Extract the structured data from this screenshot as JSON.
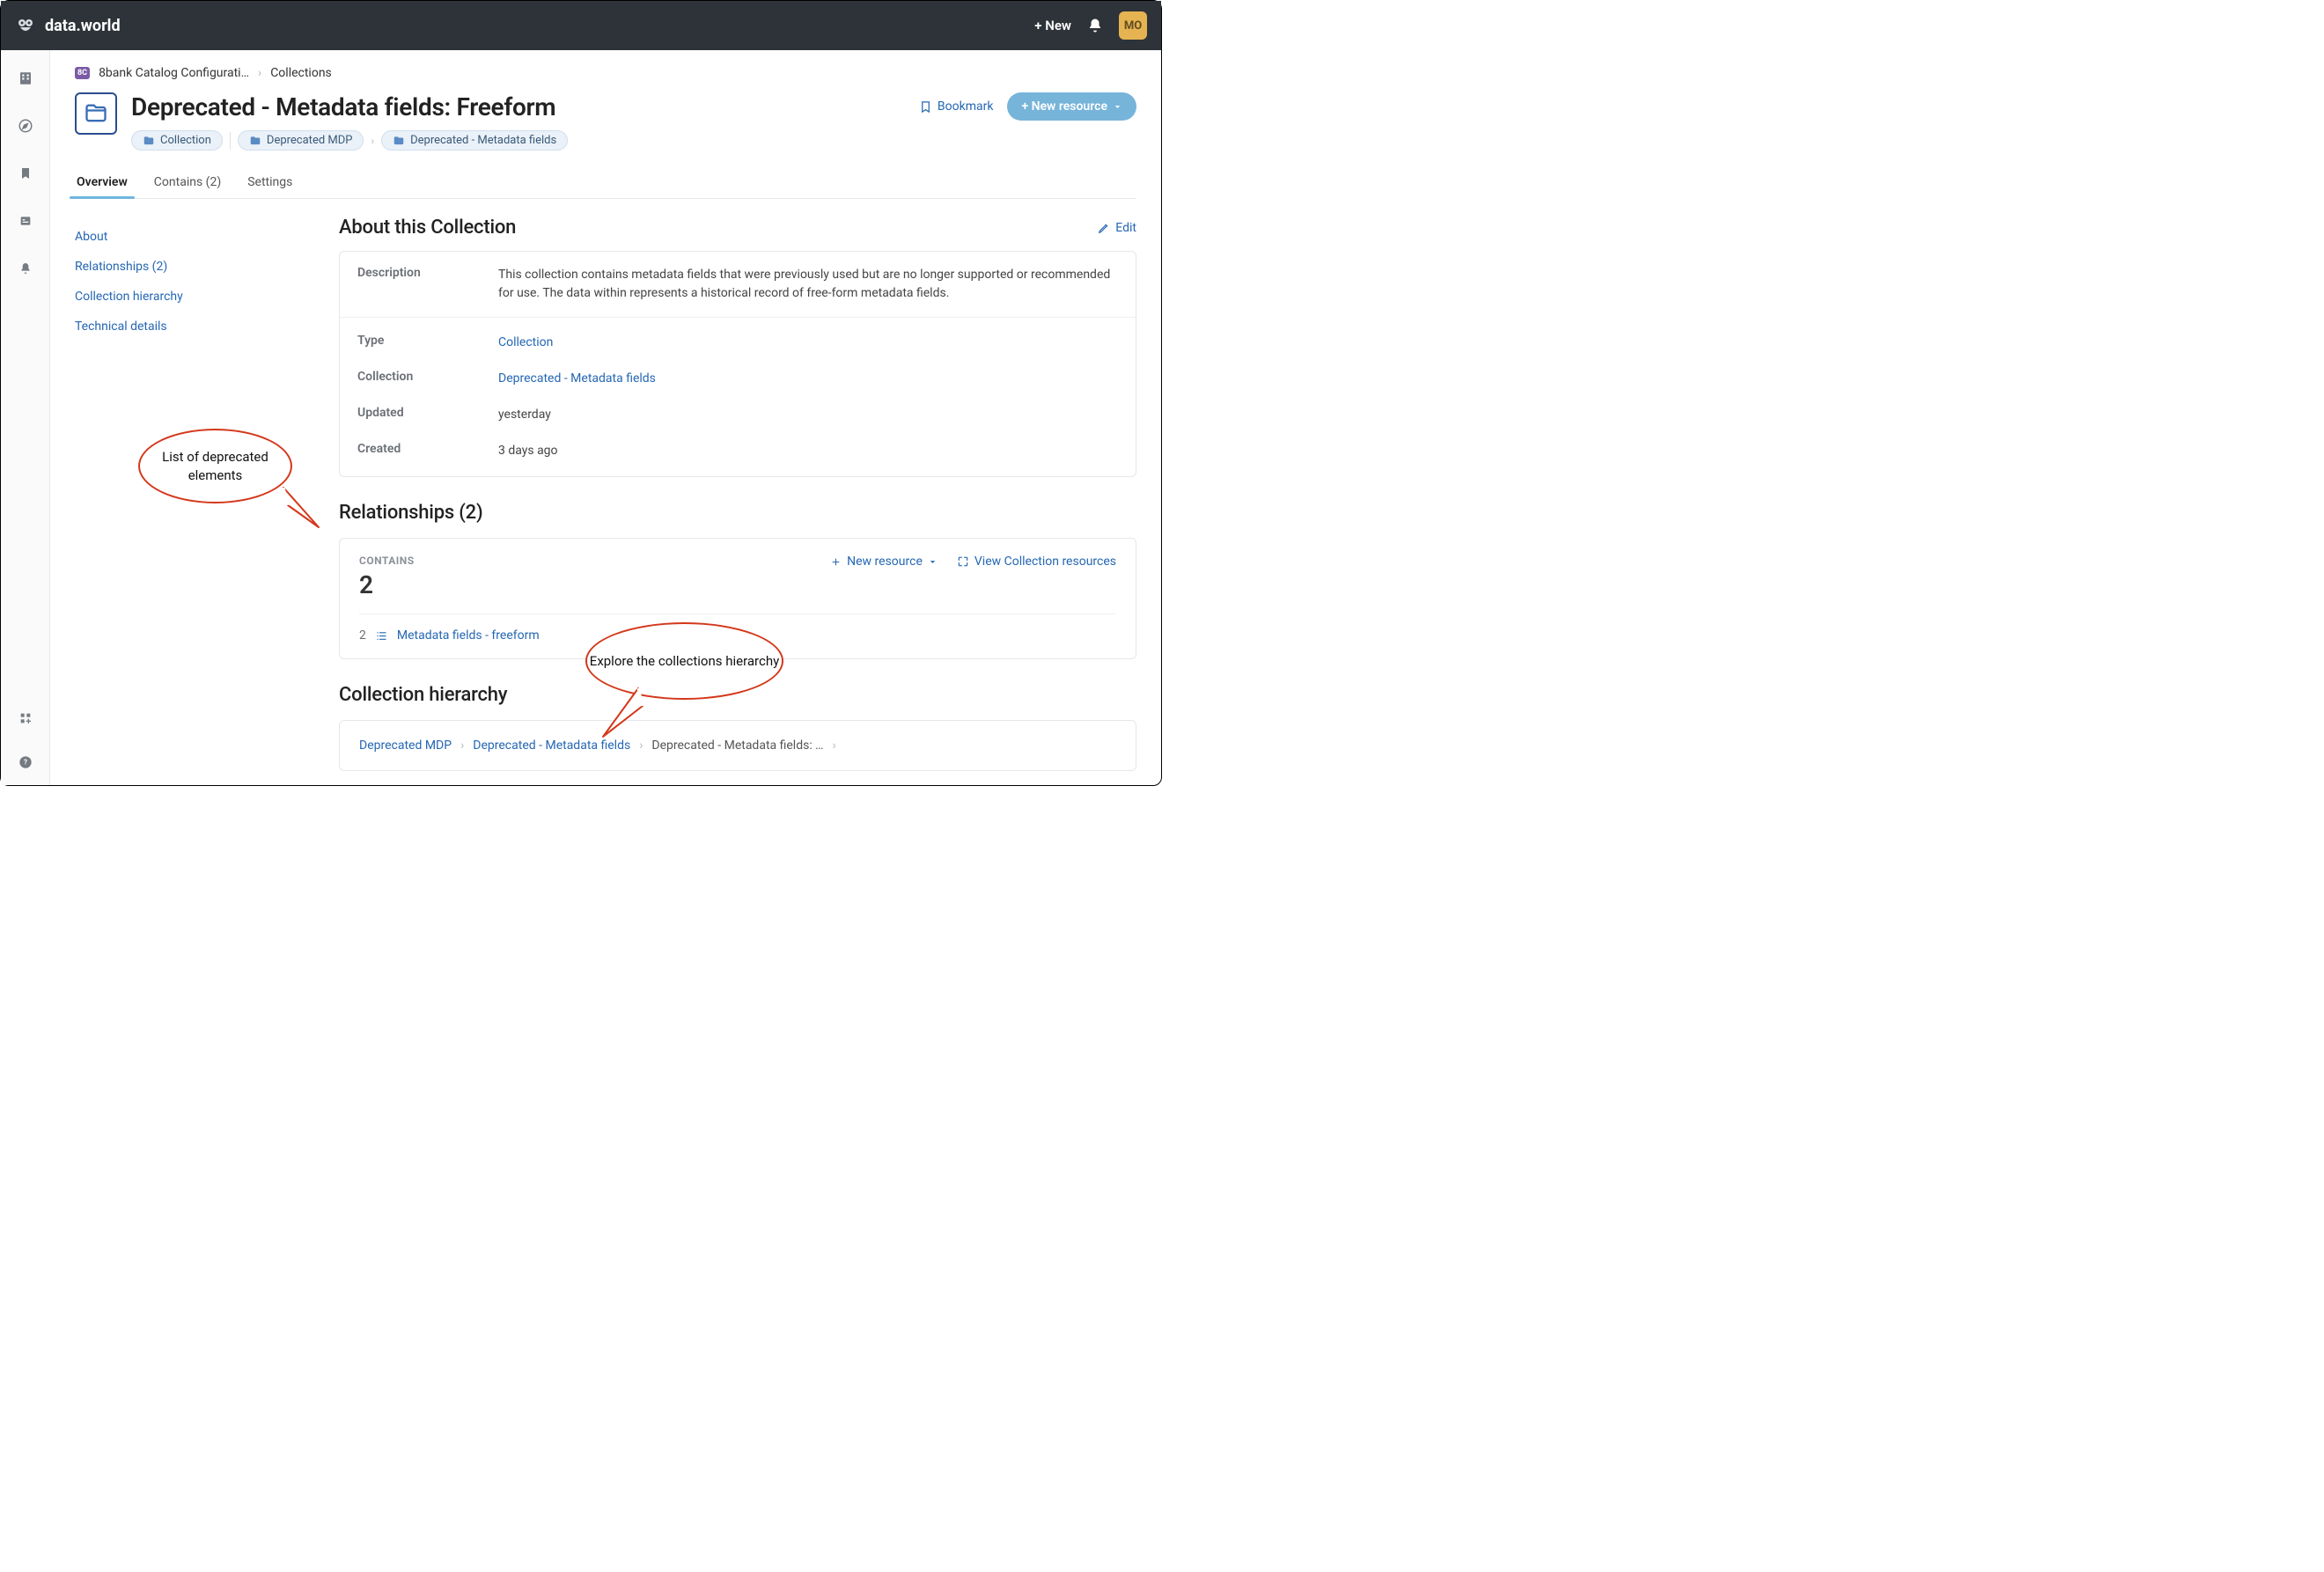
{
  "topbar": {
    "logo": "data.world",
    "new_label": "+ New",
    "avatar": "MO"
  },
  "breadcrumb": {
    "badge": "8C",
    "item1": "8bank Catalog Configurati…",
    "item2": "Collections"
  },
  "header": {
    "title": "Deprecated - Metadata fields: Freeform",
    "pills": {
      "p1": "Collection",
      "p2": "Deprecated MDP",
      "p3": "Deprecated - Metadata fields"
    },
    "bookmark": "Bookmark",
    "new_resource": "+ New resource"
  },
  "tabs": {
    "t1": "Overview",
    "t2": "Contains (2)",
    "t3": "Settings"
  },
  "sidenav": {
    "s1": "About",
    "s2": "Relationships (2)",
    "s3": "Collection hierarchy",
    "s4": "Technical details"
  },
  "about": {
    "title": "About this Collection",
    "edit": "Edit",
    "desc_label": "Description",
    "desc_value": "This collection contains metadata fields that were previously used but are no longer supported or recommended for use. The data within represents a historical record of free-form metadata fields.",
    "type_label": "Type",
    "type_value": "Collection",
    "coll_label": "Collection",
    "coll_value": "Deprecated - Metadata fields",
    "updated_label": "Updated",
    "updated_value": "yesterday",
    "created_label": "Created",
    "created_value": "3 days ago"
  },
  "relationships": {
    "title": "Relationships (2)",
    "contains_label": "CONTAINS",
    "contains_count": "2",
    "new_resource": "New resource",
    "view_all": "View Collection resources",
    "item_count": "2",
    "item_label": "Metadata fields - freeform"
  },
  "hierarchy": {
    "title": "Collection hierarchy",
    "h1": "Deprecated MDP",
    "h2": "Deprecated - Metadata fields",
    "h3": "Deprecated - Metadata fields: …"
  },
  "annotations": {
    "a1": "List of deprecated elements",
    "a2": "Explore the collections hierarchy"
  }
}
